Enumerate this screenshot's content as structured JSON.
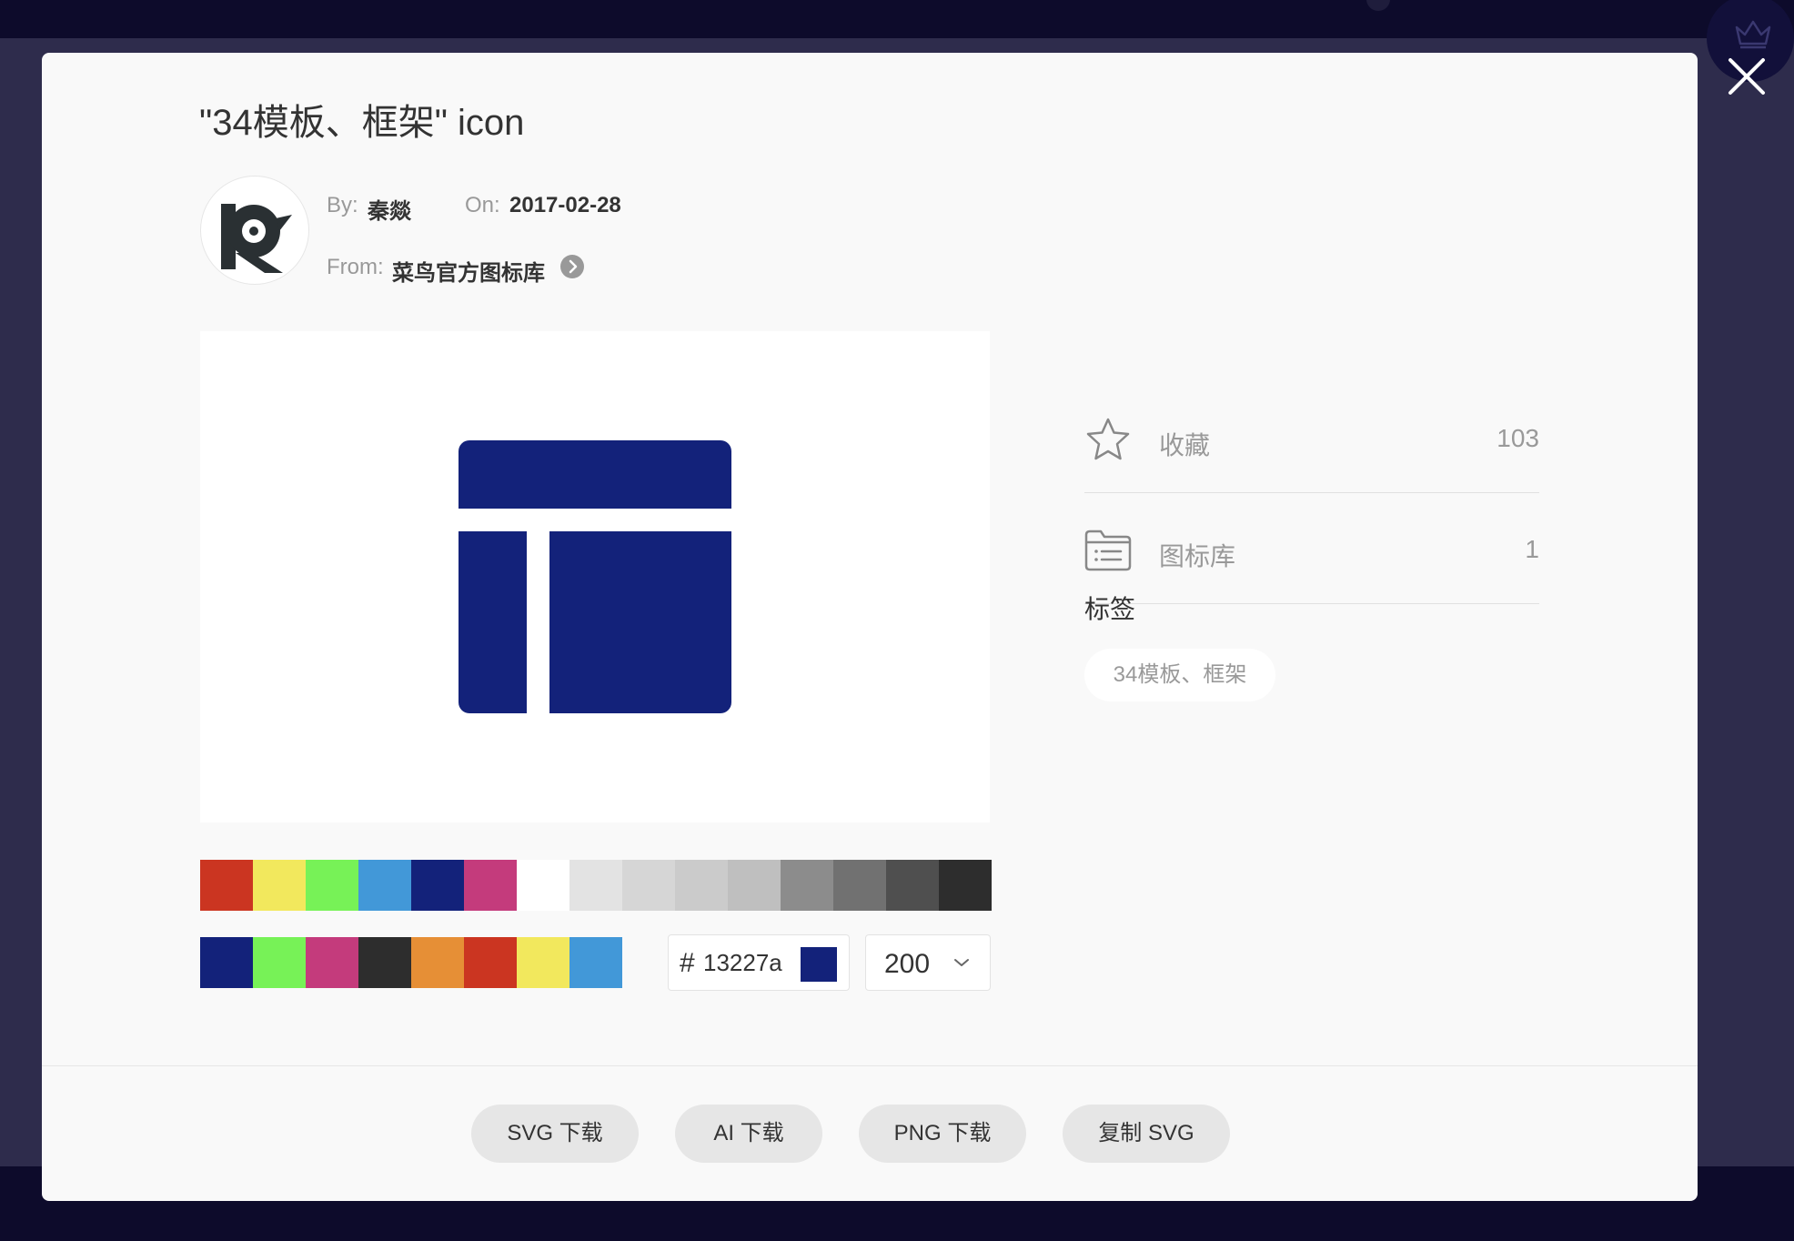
{
  "modal": {
    "title": "\"34模板、框架\" icon",
    "author": {
      "by_label": "By:",
      "by_value": "秦燚",
      "on_label": "On:",
      "on_value": "2017-02-28",
      "from_label": "From:",
      "from_value": "菜鸟官方图标库",
      "avatar_icon": "rookie-logo-icon"
    },
    "icon_color": "#13227a",
    "palette_main": [
      "#cb3521",
      "#f2e85d",
      "#77f257",
      "#4298d8",
      "#13227a",
      "#c43b7c",
      "#ffffff",
      "#e3e3e3",
      "#d6d6d6",
      "#cbcbcb",
      "#bfbfbf",
      "#8c8c8c",
      "#717171",
      "#4f4f4f",
      "#2d2d2d"
    ],
    "palette_recent": [
      "#13227a",
      "#77f257",
      "#c43b7c",
      "#2d2d2d",
      "#e68f36",
      "#cb3521",
      "#f2e85d",
      "#4298d8"
    ],
    "hex_symbol": "#",
    "hex_value": "13227a",
    "size_value": "200",
    "stats": {
      "favorites_label": "收藏",
      "favorites_count": "103",
      "libraries_label": "图标库",
      "libraries_count": "1"
    },
    "tags_heading": "标签",
    "tags": [
      "34模板、框架"
    ],
    "buttons": {
      "svg_download": "SVG 下载",
      "ai_download": "AI 下载",
      "png_download": "PNG 下载",
      "copy_svg": "复制 SVG"
    }
  }
}
